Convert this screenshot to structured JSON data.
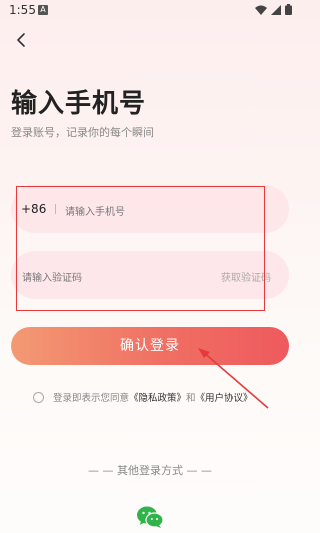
{
  "status_bar": {
    "time": "1:55",
    "notification_letter": "A"
  },
  "header": {
    "title": "输入手机号",
    "subtitle": "登录账号，记录你的每个瞬间"
  },
  "form": {
    "country_code": "+86",
    "phone_placeholder": "请输入手机号",
    "code_placeholder": "请输入验证码",
    "get_code_label": "获取验证码",
    "confirm_label": "确认登录"
  },
  "agreement": {
    "prefix": "登录即表示您同意",
    "privacy_link": "《隐私政策》",
    "and_text": "和",
    "terms_link": "《用户协议》"
  },
  "other_login": {
    "label": "— — 其他登录方式 — —",
    "icon": "wechat-icon"
  },
  "colors": {
    "accent": "#ee5a5e",
    "button_start": "#f39a73",
    "button_end": "#ee5a5e",
    "annotation": "#e63a3a"
  }
}
